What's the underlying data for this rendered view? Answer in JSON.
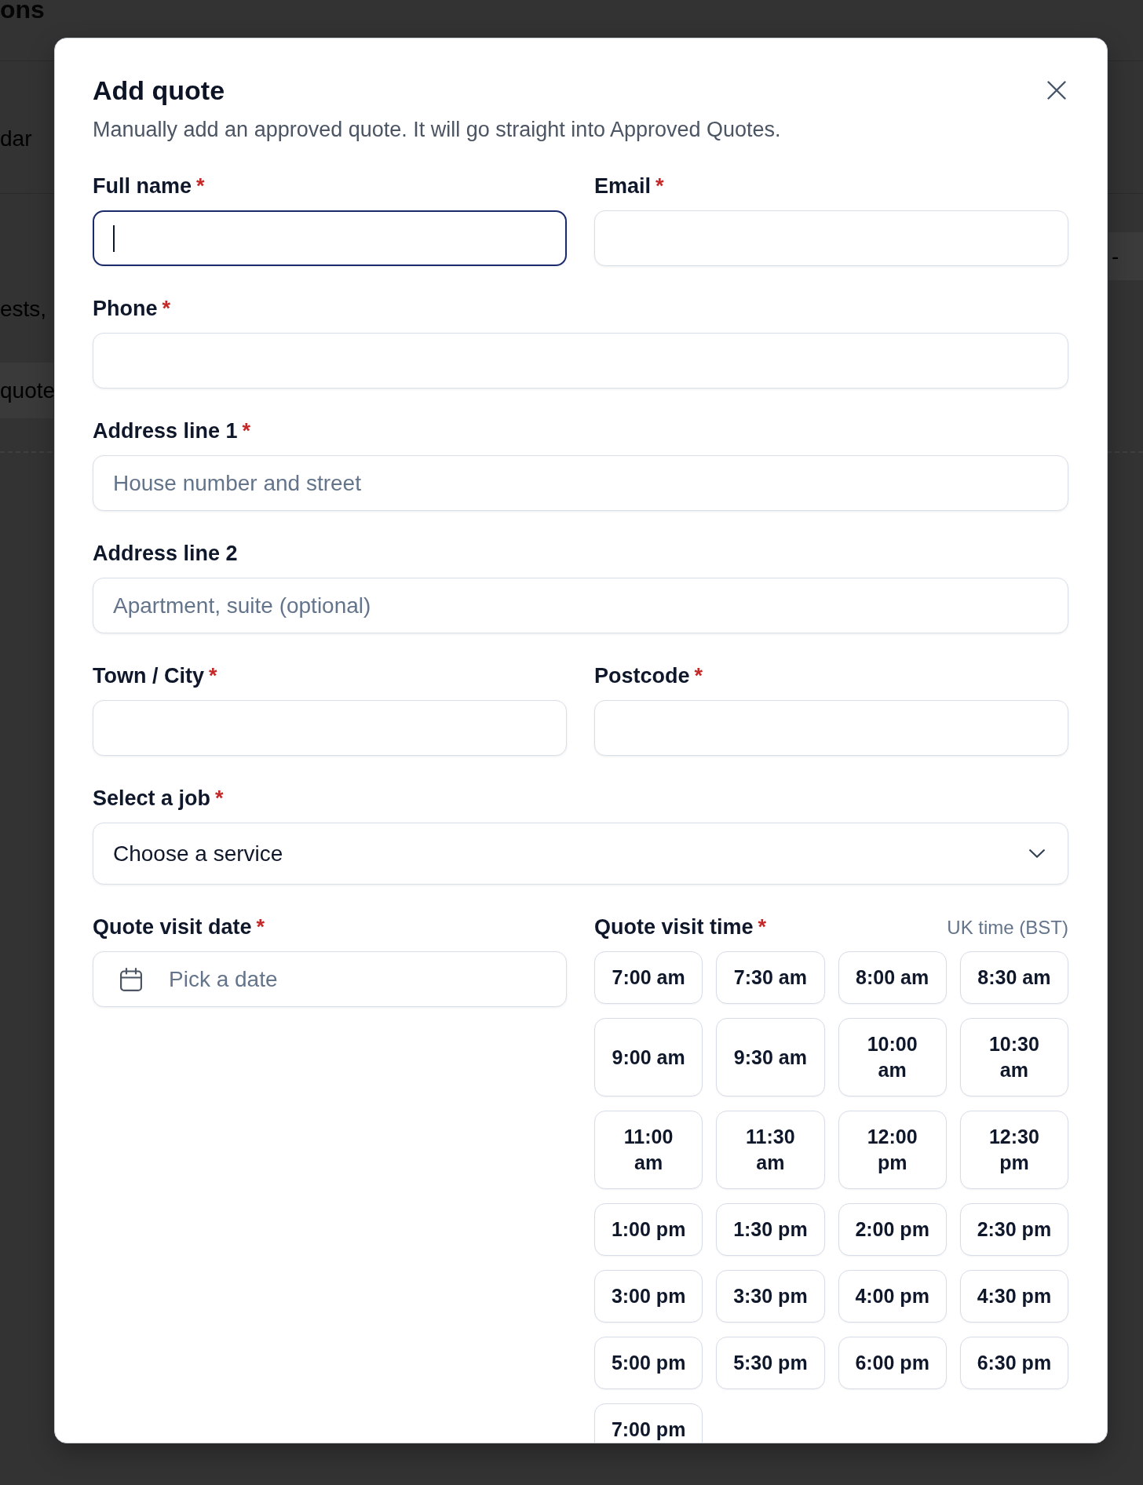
{
  "background": {
    "heading": "ons",
    "nav_tab": "dar",
    "description": "ests,",
    "button": "quote",
    "field": "-"
  },
  "dialog": {
    "title": "Add quote",
    "description": "Manually add an approved quote. It will go straight into Approved Quotes.",
    "rows": [
      [
        {
          "kind": "text",
          "label": "Full name",
          "mark": "*",
          "focused": true
        },
        {
          "kind": "text",
          "label": "Email",
          "mark": "*",
          "focused": false
        }
      ],
      [
        {
          "kind": "text",
          "label": "Phone",
          "mark": "*",
          "focused": false
        }
      ],
      [
        {
          "kind": "text",
          "label": "Address line 1",
          "mark": "*",
          "placeholder": "House number and street",
          "focused": false
        }
      ],
      [
        {
          "kind": "text",
          "label": "Address line 2",
          "placeholder": "Apartment, suite (optional)",
          "focused": false
        }
      ],
      [
        {
          "kind": "text",
          "label": "Town / City",
          "mark": "*",
          "focused": false
        },
        {
          "kind": "text",
          "label": "Postcode",
          "mark": "*",
          "focused": false
        }
      ],
      [
        {
          "kind": "select",
          "label": "Select a job",
          "mark": "*",
          "value": "Choose a service",
          "focused": false
        }
      ],
      [
        {
          "kind": "date",
          "label": "Quote visit date",
          "mark": "*",
          "placeholder": "Pick a date",
          "focused": false
        },
        {
          "kind": "time_slots",
          "label": "Quote visit time",
          "mark": "*",
          "note": "UK time (BST)",
          "slots": [
            {
              "label": "7:00 am",
              "selected": false
            },
            {
              "label": "7:30 am",
              "selected": false
            },
            {
              "label": "8:00 am",
              "selected": false
            },
            {
              "label": "8:30 am",
              "selected": false
            },
            {
              "label": "9:00 am",
              "selected": false
            },
            {
              "label": "9:30 am",
              "selected": false
            },
            {
              "label": "10:00 am",
              "selected": false
            },
            {
              "label": "10:30 am",
              "selected": false
            },
            {
              "label": "11:00 am",
              "selected": false
            },
            {
              "label": "11:30 am",
              "selected": false
            },
            {
              "label": "12:00 pm",
              "selected": false
            },
            {
              "label": "12:30 pm",
              "selected": false
            },
            {
              "label": "1:00 pm",
              "selected": false
            },
            {
              "label": "1:30 pm",
              "selected": false
            },
            {
              "label": "2:00 pm",
              "selected": false
            },
            {
              "label": "2:30 pm",
              "selected": false
            },
            {
              "label": "3:00 pm",
              "selected": false
            },
            {
              "label": "3:30 pm",
              "selected": false
            },
            {
              "label": "4:00 pm",
              "selected": false
            },
            {
              "label": "4:30 pm",
              "selected": false
            },
            {
              "label": "5:00 pm",
              "selected": false
            },
            {
              "label": "5:30 pm",
              "selected": false
            },
            {
              "label": "6:00 pm",
              "selected": false
            },
            {
              "label": "6:30 pm",
              "selected": false
            },
            {
              "label": "7:00 pm",
              "selected": false
            }
          ]
        }
      ]
    ]
  }
}
